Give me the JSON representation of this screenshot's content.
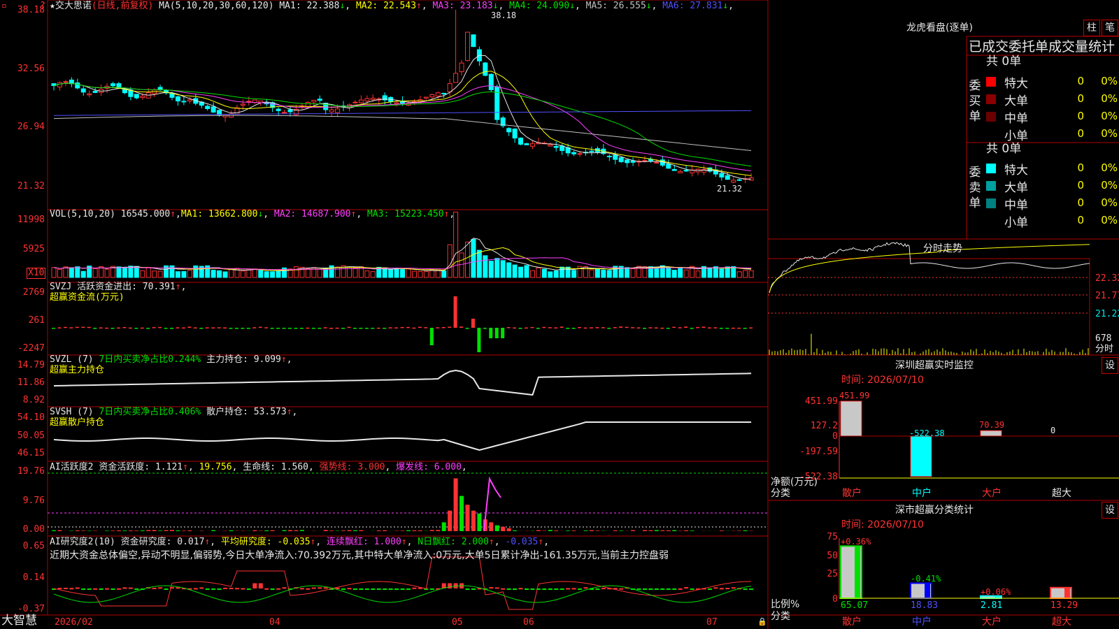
{
  "stock": {
    "name": "交大思诺",
    "mode": "(日线,前复权)"
  },
  "ma": {
    "params": "MA(5,10,20,30,60,120)",
    "items": [
      {
        "label": "MA1:",
        "value": "22.388",
        "arrow": "↓",
        "color": "#e8e8e8"
      },
      {
        "label": "MA2:",
        "value": "22.543",
        "arrow": "↑",
        "color": "#ffff00"
      },
      {
        "label": "MA3:",
        "value": "23.183",
        "arrow": "↓",
        "color": "#ff40ff"
      },
      {
        "label": "MA4:",
        "value": "24.090",
        "arrow": "↓",
        "color": "#00e000"
      },
      {
        "label": "MA5:",
        "value": "26.555",
        "arrow": "↓",
        "color": "#c0c0c0"
      },
      {
        "label": "MA6:",
        "value": "27.831",
        "arrow": "↓",
        "color": "#5050ff"
      }
    ]
  },
  "price_axis": [
    "38.18",
    "32.56",
    "26.94",
    "21.32"
  ],
  "annotations": {
    "high": "38.18",
    "low": "21.32"
  },
  "vol": {
    "params": "VOL(5,10,20)",
    "value": "16545.000",
    "arrow": "↑",
    "items": [
      {
        "label": "MA1:",
        "value": "13662.800",
        "arrow": "↓",
        "color": "#ffff00"
      },
      {
        "label": "MA2:",
        "value": "14687.900",
        "arrow": "↑",
        "color": "#ff40ff"
      },
      {
        "label": "MA3:",
        "value": "15223.450",
        "arrow": "↑",
        "color": "#00e000"
      }
    ],
    "axis": [
      "11998",
      "5925"
    ],
    "unit": "X10"
  },
  "svzj": {
    "name": "SVZJ",
    "label": "活跃资金进出:",
    "value": "70.391",
    "arrow": "↑",
    "sub": "超赢资金流(万元)",
    "axis": [
      "2769",
      "261",
      "-2247"
    ]
  },
  "svzl": {
    "name": "SVZL (7)",
    "label1": "7日内买卖净占比0.244%",
    "label2": "主力持仓:",
    "value": "9.099",
    "arrow": "↑",
    "sub": "超赢主力持仓",
    "axis": [
      "14.79",
      "11.86",
      "8.92"
    ]
  },
  "svsh": {
    "name": "SVSH (7)",
    "label1": "7日内买卖净占比0.406%",
    "label2": "散户持仓:",
    "value": "53.573",
    "arrow": "↑",
    "sub": "超赢散户持仓",
    "axis": [
      "54.10",
      "50.05",
      "46.15"
    ]
  },
  "ai1": {
    "name": "AI活跃度2",
    "items": [
      {
        "text": "资金活跃度: 1.121",
        "arrow": "↑",
        "color": "#e8e8e8"
      },
      {
        "text": "19.756",
        "arrow": "",
        "color": "#ffff00"
      },
      {
        "text": "生命线: 1.560",
        "arrow": "",
        "color": "#e8e8e8"
      },
      {
        "text": "强势线: 3.000",
        "arrow": "",
        "color": "#ff3232"
      },
      {
        "text": "爆发线: 6.000",
        "arrow": "",
        "color": "#ff40ff"
      }
    ],
    "axis": [
      "19.76",
      "9.76",
      "0.00"
    ]
  },
  "ai2": {
    "name": "AI研究度2(10)",
    "items": [
      {
        "text": "资金研究度: 0.017",
        "arrow": "↑",
        "color": "#e8e8e8"
      },
      {
        "text": "平均研究度: -0.035",
        "arrow": "↑",
        "color": "#ffff00"
      },
      {
        "text": "连续飘红: 1.000",
        "arrow": "↑",
        "color": "#ff40ff"
      },
      {
        "text": "N日飘红: 2.000",
        "arrow": "↑",
        "color": "#00e000"
      },
      {
        "text": "-0.035",
        "arrow": "↑",
        "color": "#5050ff"
      }
    ],
    "comment": "近期大资金总体偏空,异动不明显,偏弱势,今日大单净流入:70.392万元,其中特大单净流入:0万元,大单5日累计净出-161.35万元,当前主力控盘弱",
    "axis": [
      "0.65",
      "0.14",
      "-0.37"
    ]
  },
  "dates": [
    "2026/02",
    "04",
    "05",
    "06",
    "07"
  ],
  "brand": "大智慧",
  "lhb": {
    "title": "龙虎看盘(逐单)",
    "btn1": "柱",
    "btn2": "笔",
    "subtitle": "已成交委托单成交量统计",
    "buy": {
      "side": "委买单",
      "total": "共 0单",
      "rows": [
        {
          "name": "特大",
          "value": "0",
          "pct": "0%",
          "color": "#ff0000"
        },
        {
          "name": "大单",
          "value": "0",
          "pct": "0%",
          "color": "#8b0000"
        },
        {
          "name": "中单",
          "value": "0",
          "pct": "0%",
          "color": "#6a0000"
        },
        {
          "name": "小单",
          "value": "0",
          "pct": "0%",
          "color": "#000000"
        }
      ]
    },
    "sell": {
      "side": "委卖单",
      "total": "共 0单",
      "rows": [
        {
          "name": "特大",
          "value": "0",
          "pct": "0%",
          "color": "#00ffff"
        },
        {
          "name": "大单",
          "value": "0",
          "pct": "0%",
          "color": "#00a0a0"
        },
        {
          "name": "中单",
          "value": "0",
          "pct": "0%",
          "color": "#008080"
        },
        {
          "name": "小单",
          "value": "0",
          "pct": "0%",
          "color": "#000000"
        }
      ]
    }
  },
  "fenshi": {
    "title": "分时走势",
    "price_axis": [
      "22.32",
      "21.77",
      "21.22"
    ],
    "vol_value": "678",
    "vol_label": "分时"
  },
  "monitor": {
    "title": "深圳超赢实时监控",
    "btn": "设",
    "time": "时间: 2026/07/10",
    "axis": [
      "451.99",
      "127.2",
      "0",
      "-197.59",
      "-522.38"
    ],
    "bars": [
      {
        "cat": "散户",
        "value": 451.99,
        "label": "451.99"
      },
      {
        "cat": "中户",
        "value": -522.38,
        "label": "-522.38"
      },
      {
        "cat": "大户",
        "value": 70.39,
        "label": "70.39"
      },
      {
        "cat": "超大",
        "value": 0,
        "label": "0"
      }
    ],
    "ylabel": "净额(万元)",
    "xlabel": "分类"
  },
  "classify": {
    "title": "深市超赢分类统计",
    "btn": "设",
    "time": "时间: 2026/07/10",
    "axis": [
      "75",
      "50",
      "25",
      "0"
    ],
    "bars": [
      {
        "cat": "散户",
        "value": 65.07,
        "label": "65.07",
        "chg": "+0.36%"
      },
      {
        "cat": "中户",
        "value": 18.83,
        "label": "18.83",
        "chg": "-0.41%"
      },
      {
        "cat": "大户",
        "value": 2.81,
        "label": "2.81",
        "chg": "+0.06%"
      },
      {
        "cat": "超大",
        "value": 13.29,
        "label": "13.29",
        "chg": ""
      }
    ],
    "ylabel": "比例%",
    "xlabel": "分类"
  }
}
